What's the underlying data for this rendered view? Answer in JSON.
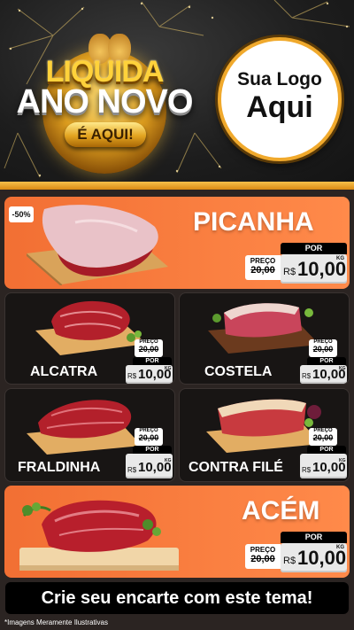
{
  "header": {
    "badge": {
      "line1": "LIQUIDA",
      "line2": "ANO NOVO",
      "pill": "É AQUI!"
    },
    "logo": {
      "line1": "Sua Logo",
      "line2": "Aqui"
    }
  },
  "discount_badge": "-50%",
  "products": [
    {
      "name": "PICANHA",
      "por": "POR",
      "preco": "PREÇO",
      "old_price": "20,00",
      "currency": "R$",
      "new_price": "10,00",
      "unit": "KG"
    },
    {
      "name": "ALCATRA",
      "por": "POR",
      "preco": "PREÇO",
      "old_price": "20,00",
      "currency": "R$",
      "new_price": "10,00",
      "unit": "KG"
    },
    {
      "name": "COSTELA",
      "por": "POR",
      "preco": "PREÇO",
      "old_price": "20,00",
      "currency": "R$",
      "new_price": "10,00",
      "unit": "KG"
    },
    {
      "name": "FRALDINHA",
      "por": "POR",
      "preco": "PREÇO",
      "old_price": "20,00",
      "currency": "R$",
      "new_price": "10,00",
      "unit": "KG"
    },
    {
      "name": "CONTRA FILÉ",
      "por": "POR",
      "preco": "PREÇO",
      "old_price": "20,00",
      "currency": "R$",
      "new_price": "10,00",
      "unit": "KG"
    },
    {
      "name": "ACÉM",
      "por": "POR",
      "preco": "PREÇO",
      "old_price": "20,00",
      "currency": "R$",
      "new_price": "10,00",
      "unit": "KG"
    }
  ],
  "cta": "Crie seu encarte com este tema!",
  "disclaimer": "*Imagens Meramente Ilustrativas",
  "colors": {
    "orange": "#f26f33",
    "gold": "#f0a92c",
    "dark_card": "#181514",
    "background": "#2b2422"
  },
  "icons": [
    "firework-burst",
    "meat-cut",
    "cutting-board"
  ]
}
